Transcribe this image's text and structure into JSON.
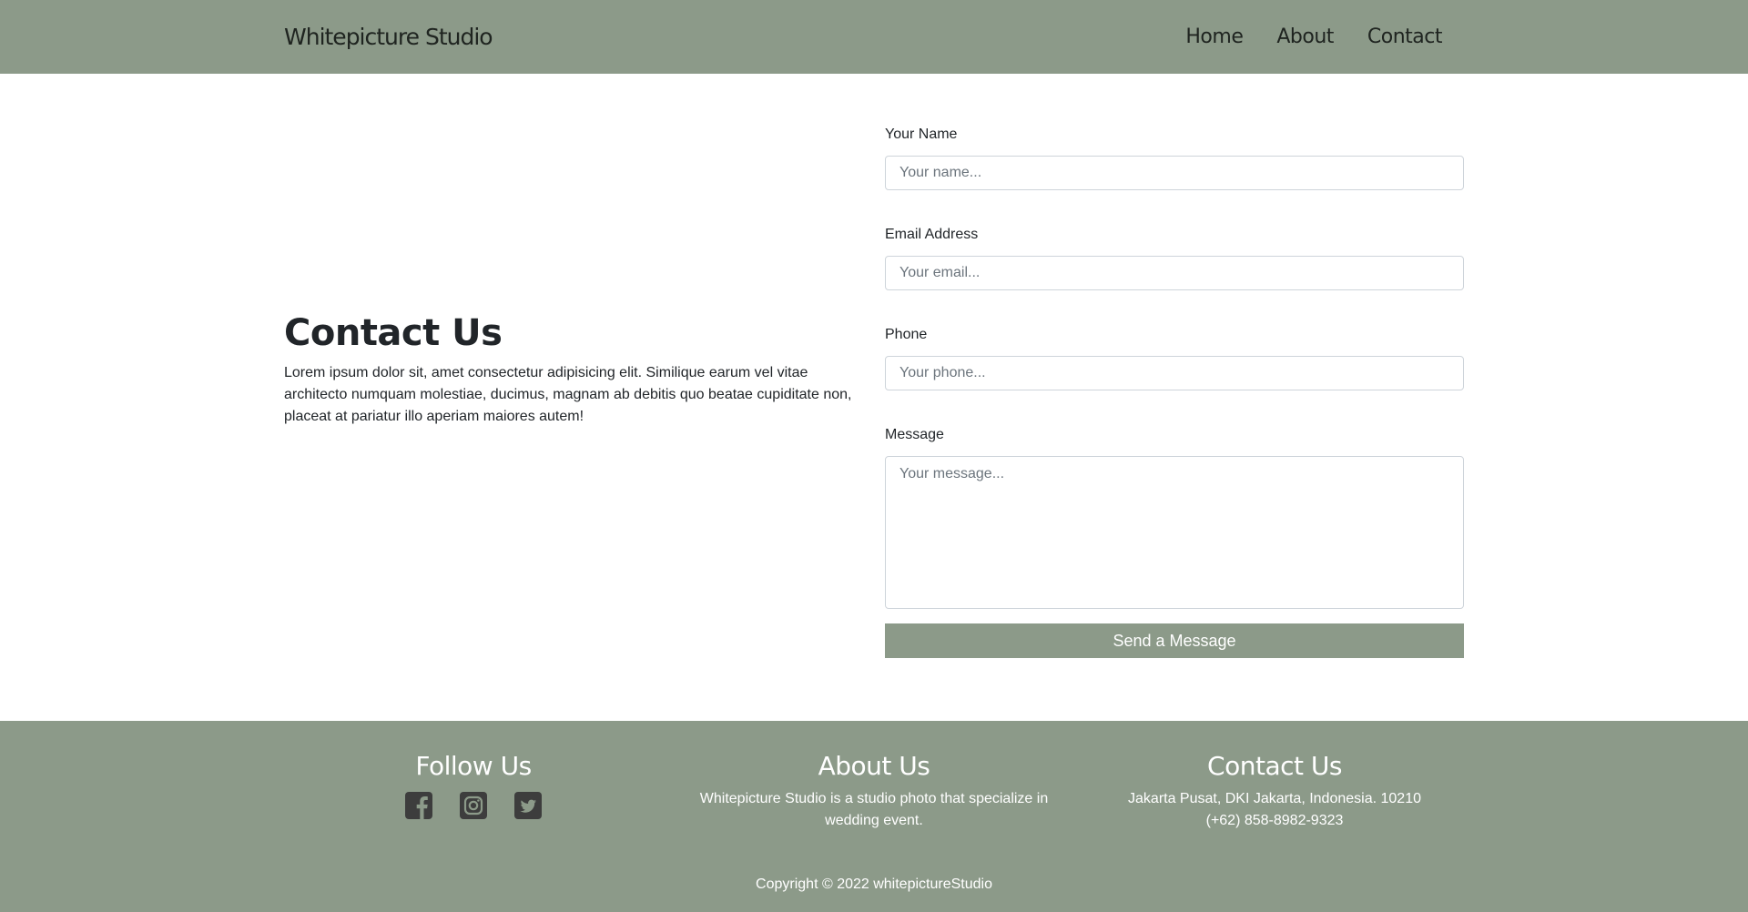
{
  "navbar": {
    "brand": "Whitepicture Studio",
    "links": [
      {
        "label": "Home"
      },
      {
        "label": "About"
      },
      {
        "label": "Contact"
      }
    ],
    "background_color": "#8c9a89"
  },
  "intro": {
    "title": "Contact Us",
    "text": "Lorem ipsum dolor sit, amet consectetur adipisicing elit. Similique earum vel vitae architecto numquam molestiae, ducimus, magnam ab debitis quo beatae cupiditate non, placeat at pariatur illo aperiam maiores autem!"
  },
  "form": {
    "name_label": "Your Name",
    "name_placeholder": "Your name...",
    "email_label": "Email Address",
    "email_placeholder": "Your email...",
    "phone_label": "Phone",
    "phone_placeholder": "Your phone...",
    "message_label": "Message",
    "message_placeholder": "Your message...",
    "submit_label": "Send a Message"
  },
  "footer": {
    "follow_title": "Follow Us",
    "social_icons": [
      "facebook-icon",
      "instagram-icon",
      "twitter-icon"
    ],
    "about_title": "About Us",
    "about_text": "Whitepicture Studio is a studio photo that specialize in wedding event.",
    "contact_title": "Contact Us",
    "address": "Jakarta Pusat, DKI Jakarta, Indonesia. 10210",
    "phone": "(+62) 858-8982-9323",
    "copyright": "Copyright © 2022 whitepictureStudio"
  }
}
